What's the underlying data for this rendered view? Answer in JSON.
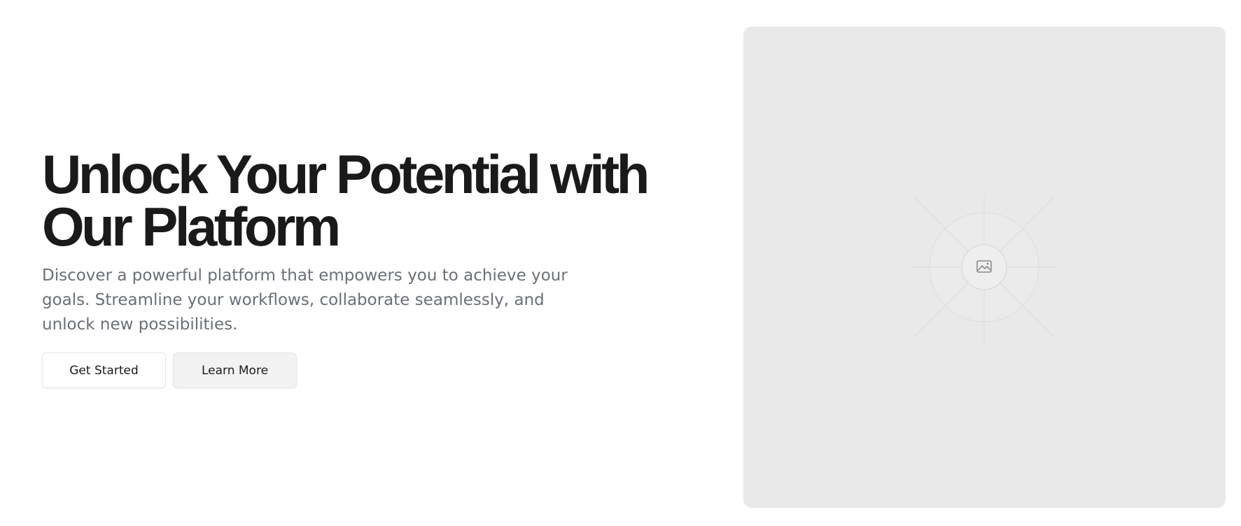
{
  "hero": {
    "headline_line1": "Unlock Your Potential with",
    "headline_line2": "Our Platform",
    "subtext": "Discover a powerful platform that empowers you to achieve your goals. Streamline your workflows, collaborate seamlessly, and unlock new possibilities.",
    "primary_button": "Get Started",
    "secondary_button": "Learn More"
  },
  "media": {
    "icon": "image-placeholder-icon"
  },
  "colors": {
    "headline": "#1a1a1a",
    "subtext": "#6b6f76",
    "placeholder_bg": "#e9e9e9",
    "secondary_button_bg": "#f2f2f2"
  }
}
